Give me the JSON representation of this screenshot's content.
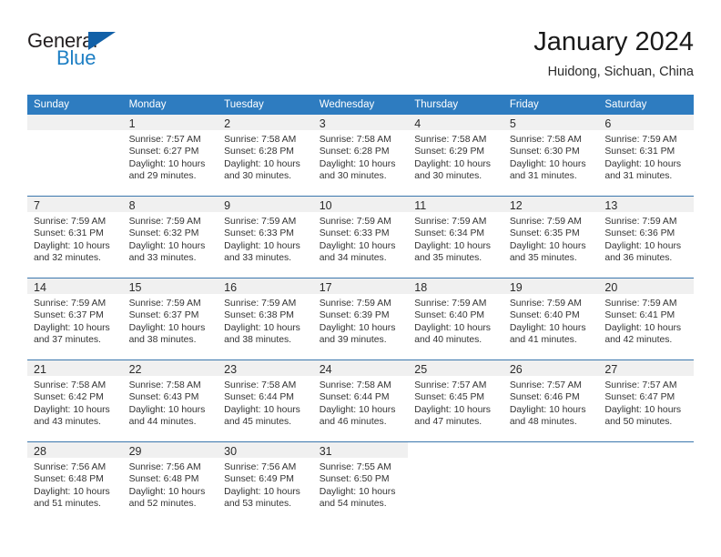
{
  "brand": {
    "name_top": "General",
    "name_bottom": "Blue",
    "triangle_color": "#1261a8",
    "blue_text_color": "#1e7fc4"
  },
  "header": {
    "month_title": "January 2024",
    "location": "Huidong, Sichuan, China"
  },
  "theme": {
    "header_blue": "#2e7cc0",
    "row_divider": "#3b77ad",
    "daynum_band": "#f0f0f0"
  },
  "weekday_headers": [
    "Sunday",
    "Monday",
    "Tuesday",
    "Wednesday",
    "Thursday",
    "Friday",
    "Saturday"
  ],
  "weeks": [
    [
      {
        "day": "",
        "lines": []
      },
      {
        "day": "1",
        "lines": [
          "Sunrise: 7:57 AM",
          "Sunset: 6:27 PM",
          "Daylight: 10 hours",
          "and 29 minutes."
        ]
      },
      {
        "day": "2",
        "lines": [
          "Sunrise: 7:58 AM",
          "Sunset: 6:28 PM",
          "Daylight: 10 hours",
          "and 30 minutes."
        ]
      },
      {
        "day": "3",
        "lines": [
          "Sunrise: 7:58 AM",
          "Sunset: 6:28 PM",
          "Daylight: 10 hours",
          "and 30 minutes."
        ]
      },
      {
        "day": "4",
        "lines": [
          "Sunrise: 7:58 AM",
          "Sunset: 6:29 PM",
          "Daylight: 10 hours",
          "and 30 minutes."
        ]
      },
      {
        "day": "5",
        "lines": [
          "Sunrise: 7:58 AM",
          "Sunset: 6:30 PM",
          "Daylight: 10 hours",
          "and 31 minutes."
        ]
      },
      {
        "day": "6",
        "lines": [
          "Sunrise: 7:59 AM",
          "Sunset: 6:31 PM",
          "Daylight: 10 hours",
          "and 31 minutes."
        ]
      }
    ],
    [
      {
        "day": "7",
        "lines": [
          "Sunrise: 7:59 AM",
          "Sunset: 6:31 PM",
          "Daylight: 10 hours",
          "and 32 minutes."
        ]
      },
      {
        "day": "8",
        "lines": [
          "Sunrise: 7:59 AM",
          "Sunset: 6:32 PM",
          "Daylight: 10 hours",
          "and 33 minutes."
        ]
      },
      {
        "day": "9",
        "lines": [
          "Sunrise: 7:59 AM",
          "Sunset: 6:33 PM",
          "Daylight: 10 hours",
          "and 33 minutes."
        ]
      },
      {
        "day": "10",
        "lines": [
          "Sunrise: 7:59 AM",
          "Sunset: 6:33 PM",
          "Daylight: 10 hours",
          "and 34 minutes."
        ]
      },
      {
        "day": "11",
        "lines": [
          "Sunrise: 7:59 AM",
          "Sunset: 6:34 PM",
          "Daylight: 10 hours",
          "and 35 minutes."
        ]
      },
      {
        "day": "12",
        "lines": [
          "Sunrise: 7:59 AM",
          "Sunset: 6:35 PM",
          "Daylight: 10 hours",
          "and 35 minutes."
        ]
      },
      {
        "day": "13",
        "lines": [
          "Sunrise: 7:59 AM",
          "Sunset: 6:36 PM",
          "Daylight: 10 hours",
          "and 36 minutes."
        ]
      }
    ],
    [
      {
        "day": "14",
        "lines": [
          "Sunrise: 7:59 AM",
          "Sunset: 6:37 PM",
          "Daylight: 10 hours",
          "and 37 minutes."
        ]
      },
      {
        "day": "15",
        "lines": [
          "Sunrise: 7:59 AM",
          "Sunset: 6:37 PM",
          "Daylight: 10 hours",
          "and 38 minutes."
        ]
      },
      {
        "day": "16",
        "lines": [
          "Sunrise: 7:59 AM",
          "Sunset: 6:38 PM",
          "Daylight: 10 hours",
          "and 38 minutes."
        ]
      },
      {
        "day": "17",
        "lines": [
          "Sunrise: 7:59 AM",
          "Sunset: 6:39 PM",
          "Daylight: 10 hours",
          "and 39 minutes."
        ]
      },
      {
        "day": "18",
        "lines": [
          "Sunrise: 7:59 AM",
          "Sunset: 6:40 PM",
          "Daylight: 10 hours",
          "and 40 minutes."
        ]
      },
      {
        "day": "19",
        "lines": [
          "Sunrise: 7:59 AM",
          "Sunset: 6:40 PM",
          "Daylight: 10 hours",
          "and 41 minutes."
        ]
      },
      {
        "day": "20",
        "lines": [
          "Sunrise: 7:59 AM",
          "Sunset: 6:41 PM",
          "Daylight: 10 hours",
          "and 42 minutes."
        ]
      }
    ],
    [
      {
        "day": "21",
        "lines": [
          "Sunrise: 7:58 AM",
          "Sunset: 6:42 PM",
          "Daylight: 10 hours",
          "and 43 minutes."
        ]
      },
      {
        "day": "22",
        "lines": [
          "Sunrise: 7:58 AM",
          "Sunset: 6:43 PM",
          "Daylight: 10 hours",
          "and 44 minutes."
        ]
      },
      {
        "day": "23",
        "lines": [
          "Sunrise: 7:58 AM",
          "Sunset: 6:44 PM",
          "Daylight: 10 hours",
          "and 45 minutes."
        ]
      },
      {
        "day": "24",
        "lines": [
          "Sunrise: 7:58 AM",
          "Sunset: 6:44 PM",
          "Daylight: 10 hours",
          "and 46 minutes."
        ]
      },
      {
        "day": "25",
        "lines": [
          "Sunrise: 7:57 AM",
          "Sunset: 6:45 PM",
          "Daylight: 10 hours",
          "and 47 minutes."
        ]
      },
      {
        "day": "26",
        "lines": [
          "Sunrise: 7:57 AM",
          "Sunset: 6:46 PM",
          "Daylight: 10 hours",
          "and 48 minutes."
        ]
      },
      {
        "day": "27",
        "lines": [
          "Sunrise: 7:57 AM",
          "Sunset: 6:47 PM",
          "Daylight: 10 hours",
          "and 50 minutes."
        ]
      }
    ],
    [
      {
        "day": "28",
        "lines": [
          "Sunrise: 7:56 AM",
          "Sunset: 6:48 PM",
          "Daylight: 10 hours",
          "and 51 minutes."
        ]
      },
      {
        "day": "29",
        "lines": [
          "Sunrise: 7:56 AM",
          "Sunset: 6:48 PM",
          "Daylight: 10 hours",
          "and 52 minutes."
        ]
      },
      {
        "day": "30",
        "lines": [
          "Sunrise: 7:56 AM",
          "Sunset: 6:49 PM",
          "Daylight: 10 hours",
          "and 53 minutes."
        ]
      },
      {
        "day": "31",
        "lines": [
          "Sunrise: 7:55 AM",
          "Sunset: 6:50 PM",
          "Daylight: 10 hours",
          "and 54 minutes."
        ]
      },
      {
        "day": "",
        "lines": []
      },
      {
        "day": "",
        "lines": []
      },
      {
        "day": "",
        "lines": []
      }
    ]
  ]
}
